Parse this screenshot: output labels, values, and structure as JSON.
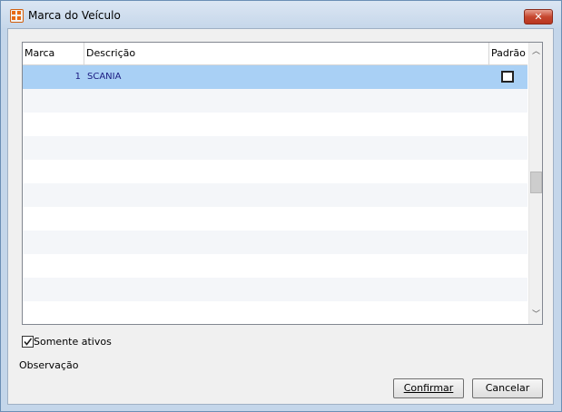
{
  "window": {
    "title": "Marca do Veículo",
    "close_label": "✕"
  },
  "grid": {
    "columns": [
      {
        "key": "marca",
        "label": "Marca"
      },
      {
        "key": "descricao",
        "label": "Descrição"
      },
      {
        "key": "padrao",
        "label": "Padrão"
      }
    ],
    "rows": [
      {
        "marca": "1",
        "descricao": "SCANIA",
        "padrao": false,
        "selected": true
      }
    ],
    "empty_rows": 11,
    "scroll_up_icon": "chevron-up-icon",
    "scroll_down_icon": "chevron-down-icon"
  },
  "filter": {
    "somente_ativos_label": "Somente ativos",
    "somente_ativos_checked": true
  },
  "observacao_label": "Observação",
  "buttons": {
    "confirm_label": "Confirmar",
    "cancel_label": "Cancelar"
  },
  "colors": {
    "selected_row": "#a9d0f5",
    "title_bar": "#c6d7ea",
    "close_button": "#c6472f"
  }
}
